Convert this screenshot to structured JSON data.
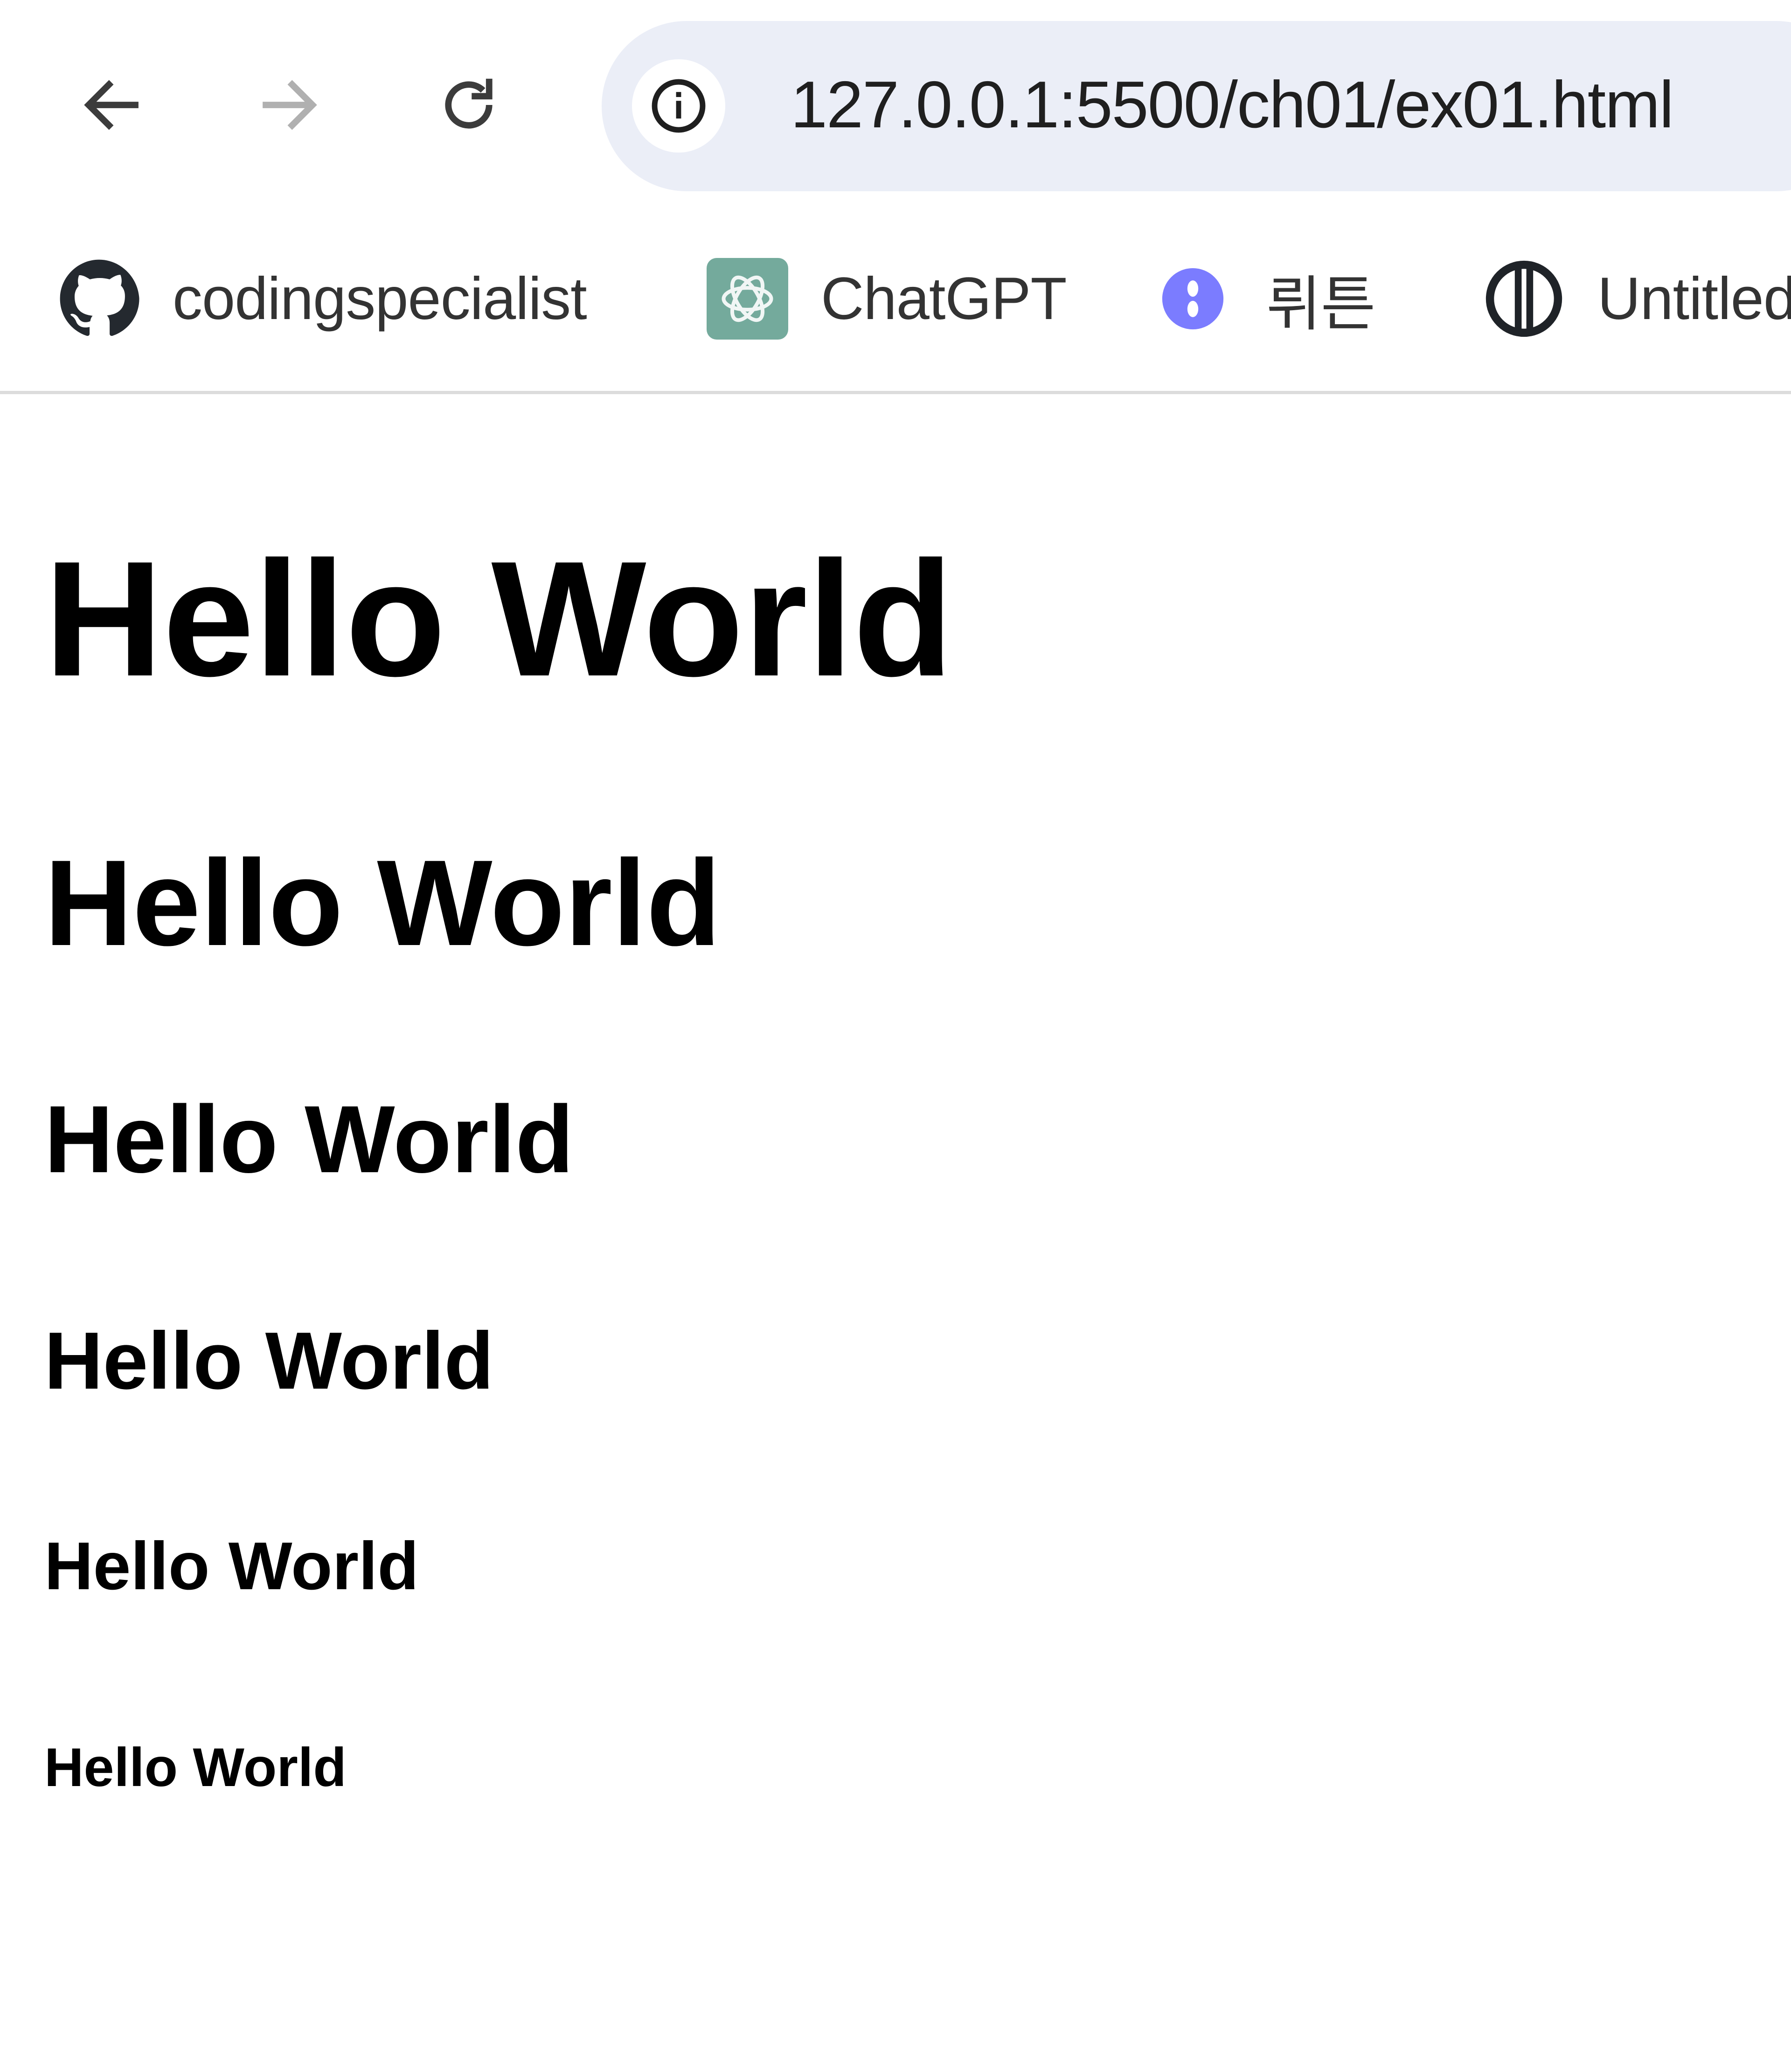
{
  "browser": {
    "nav": {
      "back_icon": "arrow-left-icon",
      "forward_icon": "arrow-right-icon",
      "reload_icon": "reload-icon"
    },
    "address_bar": {
      "site_info_icon": "info-icon",
      "url": "127.0.0.1:5500/ch01/ex01.html"
    },
    "bookmarks": [
      {
        "label": "codingspecialist",
        "icon": "github-icon"
      },
      {
        "label": "ChatGPT",
        "icon": "chatgpt-icon",
        "color": "#74aa9c"
      },
      {
        "label": "뤼튼",
        "icon": "wrtn-icon",
        "color": "#7b7cff"
      },
      {
        "label": "Untitled",
        "icon": "untitled-icon"
      }
    ]
  },
  "page": {
    "headings": [
      {
        "level": "h1",
        "text": "Hello World"
      },
      {
        "level": "h2",
        "text": "Hello World"
      },
      {
        "level": "h3",
        "text": "Hello World"
      },
      {
        "level": "h4",
        "text": "Hello World"
      },
      {
        "level": "h5",
        "text": "Hello World"
      },
      {
        "level": "h6",
        "text": "Hello World"
      }
    ]
  }
}
